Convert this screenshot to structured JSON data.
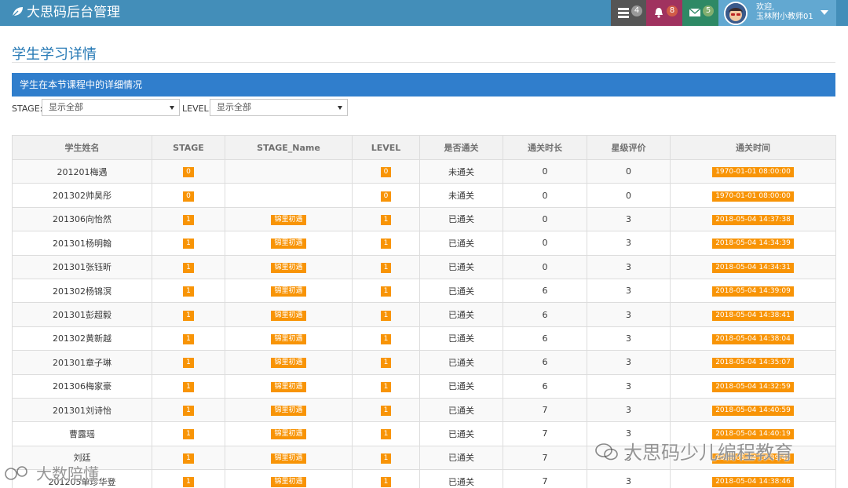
{
  "navbar": {
    "brand": "大思码后台管理",
    "tasks_badge": "4",
    "notifications_badge": "8",
    "messages_badge": "5",
    "user_greeting": "欢迎,",
    "user_name": "玉林附小教师01"
  },
  "page": {
    "title": "学生学习详情",
    "panel_title": "学生在本节课程中的详细情况"
  },
  "filters": {
    "stage_label": "STAGE:",
    "stage_value": "显示全部",
    "level_label": "LEVEL:",
    "level_value": "显示全部"
  },
  "table": {
    "columns": [
      "学生姓名",
      "STAGE",
      "STAGE_Name",
      "LEVEL",
      "是否通关",
      "通关时长",
      "星级评价",
      "通关时间"
    ],
    "rows": [
      [
        "201201梅遇",
        "0",
        "",
        "0",
        "未通关",
        "0",
        "0",
        "1970-01-01 08:00:00"
      ],
      [
        "201302帅昊彤",
        "0",
        "",
        "0",
        "未通关",
        "0",
        "0",
        "1970-01-01 08:00:00"
      ],
      [
        "201306向怡然",
        "1",
        "锦里初遇",
        "1",
        "已通关",
        "0",
        "3",
        "2018-05-04 14:37:38"
      ],
      [
        "201301杨明翰",
        "1",
        "锦里初遇",
        "1",
        "已通关",
        "0",
        "3",
        "2018-05-04 14:34:39"
      ],
      [
        "201301张钰昕",
        "1",
        "锦里初遇",
        "1",
        "已通关",
        "0",
        "3",
        "2018-05-04 14:34:31"
      ],
      [
        "201302杨锦溟",
        "1",
        "锦里初遇",
        "1",
        "已通关",
        "6",
        "3",
        "2018-05-04 14:39:09"
      ],
      [
        "201301彭超毅",
        "1",
        "锦里初遇",
        "1",
        "已通关",
        "6",
        "3",
        "2018-05-04 14:38:41"
      ],
      [
        "201302黄新越",
        "1",
        "锦里初遇",
        "1",
        "已通关",
        "6",
        "3",
        "2018-05-04 14:38:04"
      ],
      [
        "201301章子琳",
        "1",
        "锦里初遇",
        "1",
        "已通关",
        "6",
        "3",
        "2018-05-04 14:35:07"
      ],
      [
        "201306梅家豪",
        "1",
        "锦里初遇",
        "1",
        "已通关",
        "6",
        "3",
        "2018-05-04 14:32:59"
      ],
      [
        "201301刘诗怡",
        "1",
        "锦里初遇",
        "1",
        "已通关",
        "7",
        "3",
        "2018-05-04 14:40:59"
      ],
      [
        "曹露瑶",
        "1",
        "锦里初遇",
        "1",
        "已通关",
        "7",
        "3",
        "2018-05-04 14:40:19"
      ],
      [
        "刘廷",
        "1",
        "锦里初遇",
        "1",
        "已通关",
        "7",
        "3",
        "2018-05-04 14:39:42"
      ],
      [
        "201205单珍华登",
        "1",
        "锦里初遇",
        "1",
        "已通关",
        "7",
        "3",
        "2018-05-04 14:38:46"
      ]
    ]
  },
  "watermarks": {
    "right": "大思码少儿编程教育",
    "left": "大数陪懂"
  },
  "colors": {
    "navbar": "#438eb9",
    "panel_header": "#307ecc",
    "label_orange": "#f89406",
    "title_blue": "#2679b5"
  }
}
